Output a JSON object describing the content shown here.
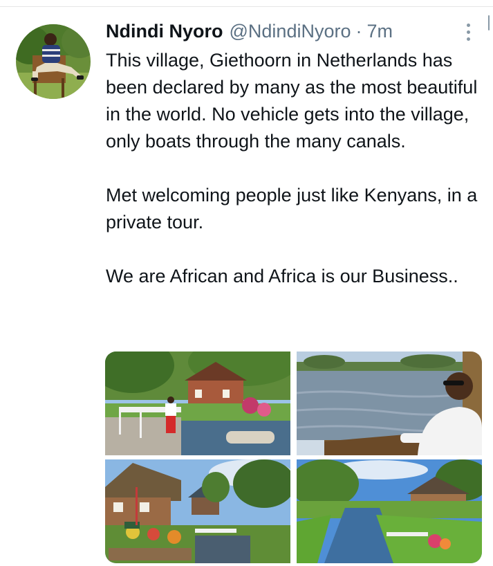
{
  "tweet": {
    "author_name": "Ndindi Nyoro",
    "handle": "@NdindiNyoro",
    "separator": "·",
    "time": "7m",
    "paragraphs": [
      "This village, Giethoorn in Netherlands has been declared by many as the most beautiful in the world. No vehicle gets into the village, only boats through the many canals.",
      "Met welcoming people just like Kenyans, in a private tour.",
      "We are African and Africa is our Business.."
    ]
  },
  "icons": {
    "more": "more-vertical-icon",
    "avatar": "profile-photo"
  },
  "colors": {
    "text": "#0f1419",
    "secondary": "#5b7083",
    "icon": "#8899a6"
  },
  "photos": [
    {
      "name": "canal-bridge-man-in-red-trousers"
    },
    {
      "name": "man-in-sunglasses-on-boat-lake"
    },
    {
      "name": "thatched-cottages-bridge-garden"
    },
    {
      "name": "canal-with-cottages-and-lawns"
    }
  ]
}
